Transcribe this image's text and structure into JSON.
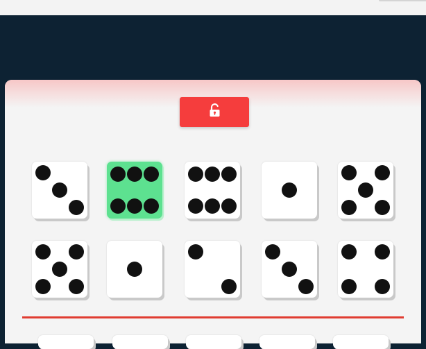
{
  "lock_button": {
    "icon": "unlocked-padlock-icon",
    "color": "#f53d3d"
  },
  "dice_rows": [
    [
      {
        "value": 3,
        "selected": false
      },
      {
        "value": 6,
        "selected": true
      },
      {
        "value": 6,
        "selected": false
      },
      {
        "value": 1,
        "selected": false
      },
      {
        "value": 5,
        "selected": false
      }
    ],
    [
      {
        "value": 5,
        "selected": false
      },
      {
        "value": 1,
        "selected": false
      },
      {
        "value": 2,
        "selected": false
      },
      {
        "value": 3,
        "selected": false
      },
      {
        "value": 4,
        "selected": false
      }
    ]
  ],
  "colors": {
    "background": "#0d2233",
    "board": "#f4f4f4",
    "selected_die": "#5de190",
    "divider": "#e03c31"
  }
}
